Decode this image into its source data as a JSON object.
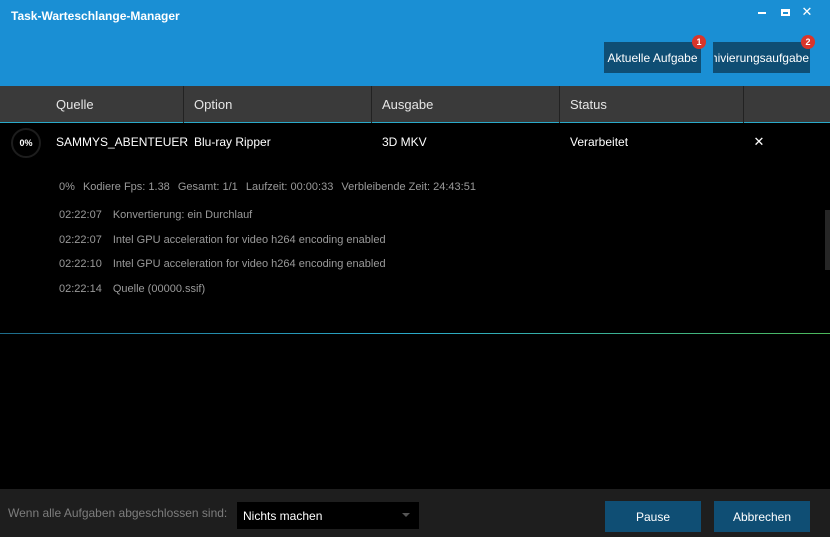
{
  "window": {
    "title": "Task-Warteschlange-Manager",
    "controls": {
      "minimize": "minimize-icon",
      "maximize": "maximize-icon",
      "close": "close-icon"
    }
  },
  "header_buttons": [
    {
      "label": "Aktuelle Aufgabe",
      "badge": "1"
    },
    {
      "label": "Archivierungsaufgabe",
      "badge": "2"
    }
  ],
  "table": {
    "columns": [
      "Quelle",
      "Option",
      "Ausgabe",
      "Status"
    ],
    "rows": [
      {
        "progress": "0%",
        "quelle": "SAMMYS_ABENTEUER",
        "option": "Blu-ray Ripper",
        "ausgabe": "3D MKV",
        "status": "Verarbeitet",
        "remove_icon": "close-icon"
      }
    ]
  },
  "details": {
    "percent": "0%",
    "fps": "Kodiere Fps: 1.38",
    "total": "Gesamt: 1/1",
    "runtime": "Laufzeit: 00:00:33",
    "remaining": "Verbleibende Zeit: 24:43:51",
    "log": [
      {
        "time": "02:22:07",
        "message": "Konvertierung: ein Durchlauf"
      },
      {
        "time": "02:22:07",
        "message": "Intel GPU acceleration for video h264 encoding enabled"
      },
      {
        "time": "02:22:10",
        "message": "Intel GPU acceleration for video h264 encoding enabled"
      },
      {
        "time": "02:22:14",
        "message": "Quelle (00000.ssif)"
      }
    ]
  },
  "footer": {
    "label": "Wenn alle Aufgaben abgeschlossen sind:",
    "select_value": "Nichts machen",
    "pause_label": "Pause",
    "cancel_label": "Abbrechen"
  },
  "colors": {
    "header_bg": "#1a8fd4",
    "button_bg": "#0f4e74",
    "badge_red": "#d9352b",
    "table_header_bg": "#3a3a3a",
    "footer_bg": "#1e1e1e"
  }
}
